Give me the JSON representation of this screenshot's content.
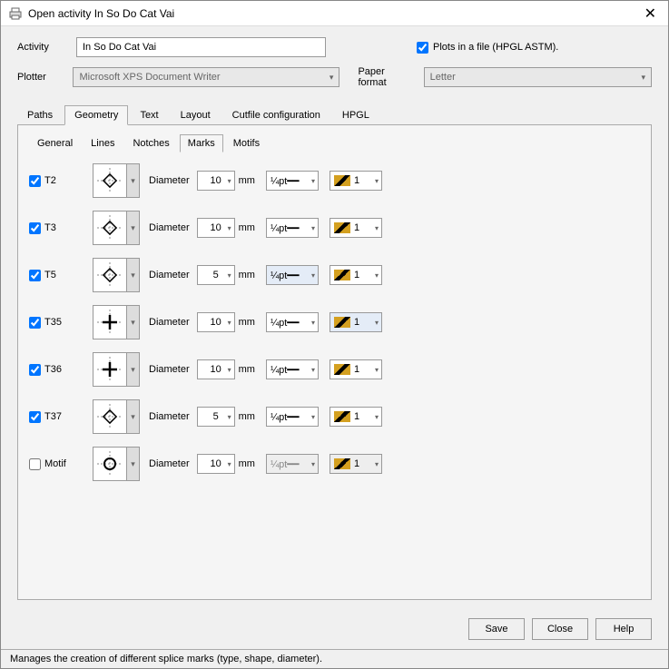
{
  "window": {
    "title": "Open activity In So Do Cat Vai"
  },
  "header": {
    "activityLabel": "Activity",
    "activityValue": "In So Do Cat Vai",
    "plotsCheckbox": "Plots in a file (HPGL ASTM).",
    "plotterLabel": "Plotter",
    "plotterValue": "Microsoft XPS Document Writer",
    "paperLabel": "Paper format",
    "paperValue": "Letter"
  },
  "mainTabs": [
    "Paths",
    "Geometry",
    "Text",
    "Layout",
    "Cutfile configuration",
    "HPGL"
  ],
  "activeMainTab": 1,
  "subTabs": [
    "General",
    "Lines",
    "Notches",
    "Marks",
    "Motifs"
  ],
  "activeSubTab": 3,
  "diameterLabel": "Diameter",
  "unitLabel": "mm",
  "lineWeightLabel": "¼pt",
  "swatchValue": "1",
  "marks": [
    {
      "name": "T2",
      "checked": true,
      "shape": "diamond",
      "diameter": 10,
      "hlSwatch": false,
      "hlLT": false,
      "disabled": false
    },
    {
      "name": "T3",
      "checked": true,
      "shape": "diamond",
      "diameter": 10,
      "hlSwatch": false,
      "hlLT": false,
      "disabled": false
    },
    {
      "name": "T5",
      "checked": true,
      "shape": "diamond",
      "diameter": 5,
      "hlSwatch": false,
      "hlLT": true,
      "disabled": false
    },
    {
      "name": "T35",
      "checked": true,
      "shape": "plus",
      "diameter": 10,
      "hlSwatch": true,
      "hlLT": false,
      "disabled": false
    },
    {
      "name": "T36",
      "checked": true,
      "shape": "plus",
      "diameter": 10,
      "hlSwatch": false,
      "hlLT": false,
      "disabled": false
    },
    {
      "name": "T37",
      "checked": true,
      "shape": "diamond",
      "diameter": 5,
      "hlSwatch": false,
      "hlLT": false,
      "disabled": false
    },
    {
      "name": "Motif",
      "checked": false,
      "shape": "circle",
      "diameter": 10,
      "hlSwatch": false,
      "hlLT": false,
      "disabled": true
    }
  ],
  "buttons": {
    "save": "Save",
    "close": "Close",
    "help": "Help"
  },
  "status": "Manages the creation of different splice marks (type, shape, diameter)."
}
